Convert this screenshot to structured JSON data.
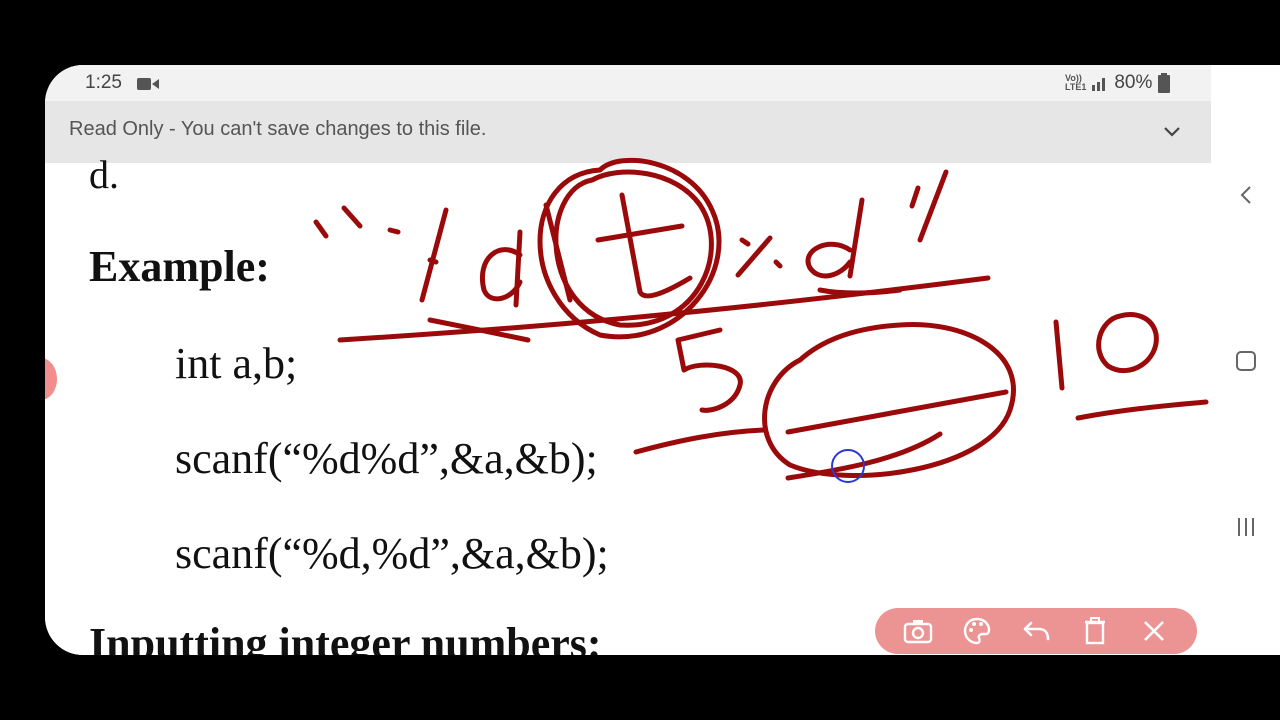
{
  "status_bar": {
    "time": "1:25",
    "network": "VoLTE1",
    "battery": "80%",
    "icons": [
      "video-camera-icon",
      "volte-icon",
      "signal-icon",
      "battery-icon"
    ]
  },
  "info_bar": {
    "message": "Read Only - You can't save changes to this file.",
    "expand_icon": "chevron-down-icon"
  },
  "document": {
    "line_d": "d.",
    "example_heading": "Example:",
    "code_int": "int a,b;",
    "code_scanf_1": "scanf(“%d%d”,&a,&b);",
    "code_scanf_2": "scanf(“%d,%d”,&a,&b);",
    "next_heading": "Inputting integer numbers:"
  },
  "annotations": {
    "format_text": "\"%d\\t%d\"",
    "number_left": "5",
    "number_right": "10",
    "ink_color": "#9b0a0a"
  },
  "nav_bar": {
    "icons": [
      "back-chevron-icon",
      "home-square-icon",
      "recents-icon"
    ]
  },
  "drawing_toolbar": {
    "background": "#ec9393",
    "tools": [
      "camera-icon",
      "palette-icon",
      "undo-icon",
      "trash-icon",
      "close-icon"
    ]
  }
}
